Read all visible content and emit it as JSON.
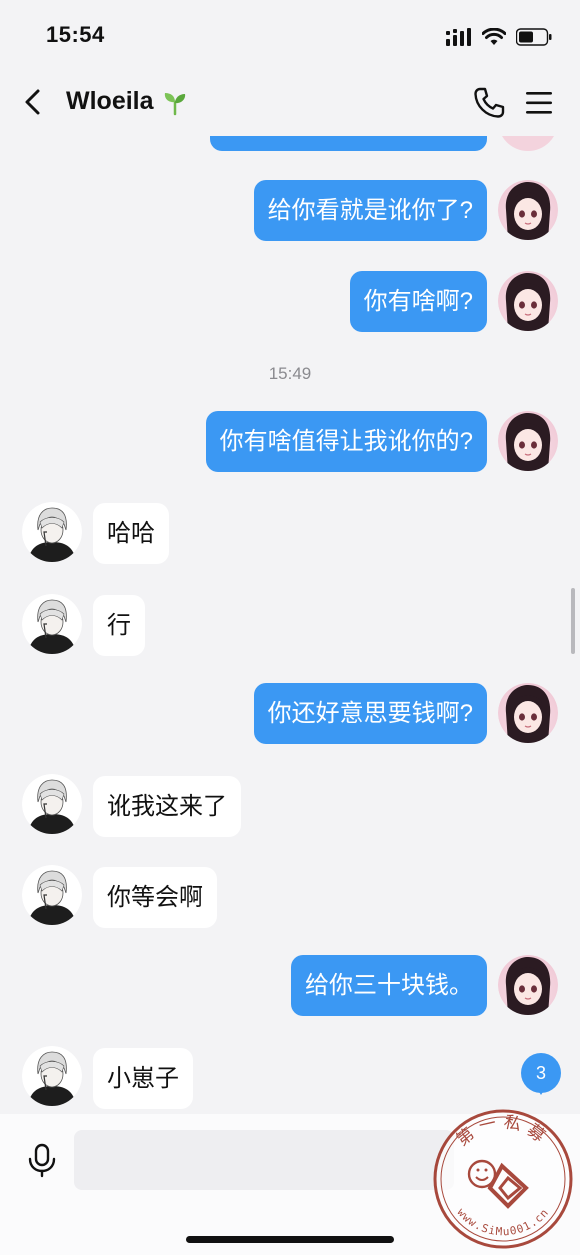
{
  "status_bar": {
    "time": "15:54"
  },
  "header": {
    "contact_name": "Wloeila"
  },
  "messages": [
    {
      "from": "me",
      "text": "给你看就是讹你了?"
    },
    {
      "from": "me",
      "text": "你有啥啊?"
    },
    {
      "type": "timestamp",
      "text": "15:49"
    },
    {
      "from": "me",
      "text": "你有啥值得让我讹你的?"
    },
    {
      "from": "them",
      "text": "哈哈"
    },
    {
      "from": "them",
      "text": "行"
    },
    {
      "from": "me",
      "text": "你还好意思要钱啊?"
    },
    {
      "from": "them",
      "text": "讹我这来了"
    },
    {
      "from": "them",
      "text": "你等会啊"
    },
    {
      "from": "me",
      "text": "给你三十块钱。"
    },
    {
      "from": "them",
      "text": "小崽子"
    }
  ],
  "unread_count": "3",
  "input": {
    "value": "",
    "placeholder": ""
  },
  "watermark": {
    "text_chinese": "第一私募",
    "text_url": "www.SiMu001.cn"
  },
  "colors": {
    "my_bubble": "#3b98f3",
    "their_bubble": "#ffffff",
    "background": "#f3f3f5"
  },
  "icons": [
    "signal-icon",
    "wifi-icon",
    "battery-icon",
    "back-icon",
    "sprout-icon",
    "phone-icon",
    "menu-icon",
    "mic-icon",
    "emoji-icon"
  ]
}
